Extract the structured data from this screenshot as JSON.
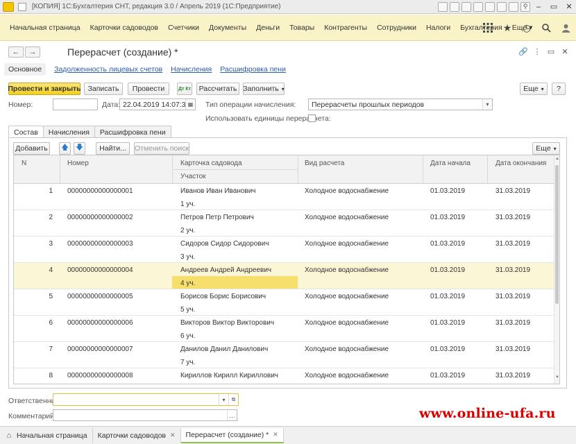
{
  "window": {
    "title": "[КОПИЯ] 1С:Бухгалтерия СНТ, редакция 3.0 / Апрель 2019 (1С:Предприятие)"
  },
  "menu": {
    "items": [
      "Начальная страница",
      "Карточки садоводов",
      "Счетчики",
      "Документы",
      "Деньги",
      "Товары",
      "Контрагенты",
      "Сотрудники",
      "Налоги",
      "Бухгалтерия",
      "Еще"
    ],
    "more_arrow": "▾",
    "icons": [
      "grid-icon",
      "star-icon",
      "history-icon",
      "search-icon",
      "user-icon"
    ]
  },
  "form": {
    "title": "Перерасчет (создание) *",
    "back": "←",
    "forward": "→",
    "tabs": [
      "Основное",
      "Задолженность лицевых счетов",
      "Начисления",
      "Расшифровка пени"
    ],
    "toolbar": {
      "post_close": "Провести и закрыть",
      "save": "Записать",
      "post": "Провести",
      "dt_kt": "Дт Кт",
      "calculate": "Рассчитать",
      "fill": "Заполнить",
      "more": "Еще",
      "help": "?"
    },
    "number_label": "Номер:",
    "number_value": "",
    "date_label": "Дата:",
    "date_value": "22.04.2019 14:07:33",
    "op_type_label": "Тип операции начисления:",
    "op_type_value": "Перерасчеты прошлых периодов",
    "use_units_label": "Использовать единицы перерасчета:",
    "use_units_checked": false,
    "inner_tabs": [
      "Состав",
      "Начисления",
      "Расшифровка пени"
    ],
    "table_toolbar": {
      "add": "Добавить",
      "find": "Найти...",
      "cancel_search": "Отменить поиск",
      "more": "Еще"
    },
    "responsible_label": "Ответственный:",
    "responsible_value": "",
    "comment_label": "Комментарий:",
    "comment_value": ""
  },
  "table": {
    "columns": {
      "n": "N",
      "number": "Номер",
      "card": "Карточка садовода",
      "plot": "Участок",
      "type": "Вид расчета",
      "start": "Дата начала",
      "end": "Дата окончания"
    },
    "rows": [
      {
        "n": "1",
        "number": "00000000000000001",
        "name": "Иванов Иван Иванович",
        "plot": "1 уч.",
        "type": "Холодное водоснабжение",
        "start": "01.03.2019",
        "end": "31.03.2019"
      },
      {
        "n": "2",
        "number": "00000000000000002",
        "name": "Петров Петр Петрович",
        "plot": "2 уч.",
        "type": "Холодное водоснабжение",
        "start": "01.03.2019",
        "end": "31.03.2019"
      },
      {
        "n": "3",
        "number": "00000000000000003",
        "name": "Сидоров Сидор Сидорович",
        "plot": "3 уч.",
        "type": "Холодное водоснабжение",
        "start": "01.03.2019",
        "end": "31.03.2019"
      },
      {
        "n": "4",
        "number": "00000000000000004",
        "name": "Андреев Андрей Андреевич",
        "plot": "4 уч.",
        "type": "Холодное водоснабжение",
        "start": "01.03.2019",
        "end": "31.03.2019"
      },
      {
        "n": "5",
        "number": "00000000000000005",
        "name": "Борисов Борис Борисович",
        "plot": "5 уч.",
        "type": "Холодное водоснабжение",
        "start": "01.03.2019",
        "end": "31.03.2019"
      },
      {
        "n": "6",
        "number": "00000000000000006",
        "name": "Викторов Виктор Викторович",
        "plot": "6 уч.",
        "type": "Холодное водоснабжение",
        "start": "01.03.2019",
        "end": "31.03.2019"
      },
      {
        "n": "7",
        "number": "00000000000000007",
        "name": "Данилов Данил Данилович",
        "plot": "7 уч.",
        "type": "Холодное водоснабжение",
        "start": "01.03.2019",
        "end": "31.03.2019"
      },
      {
        "n": "8",
        "number": "00000000000000008",
        "name": "Кириллов Кирилл Кириллович",
        "plot": "8 уч.",
        "type": "Холодное водоснабжение",
        "start": "01.03.2019",
        "end": "31.03.2019"
      }
    ],
    "selected_row": 3
  },
  "bottom_tabs": [
    {
      "label": "Начальная страница",
      "closable": false
    },
    {
      "label": "Карточки садоводов",
      "closable": true
    },
    {
      "label": "Перерасчет (создание) *",
      "closable": true
    }
  ],
  "watermark": "www.online-ufa.ru",
  "colors": {
    "menu_bg": "#fbf3c8",
    "primary_button": "#f3cf1e",
    "selected_row": "#fbf6d6",
    "link": "#2a5caa",
    "watermark": "#d80000"
  }
}
